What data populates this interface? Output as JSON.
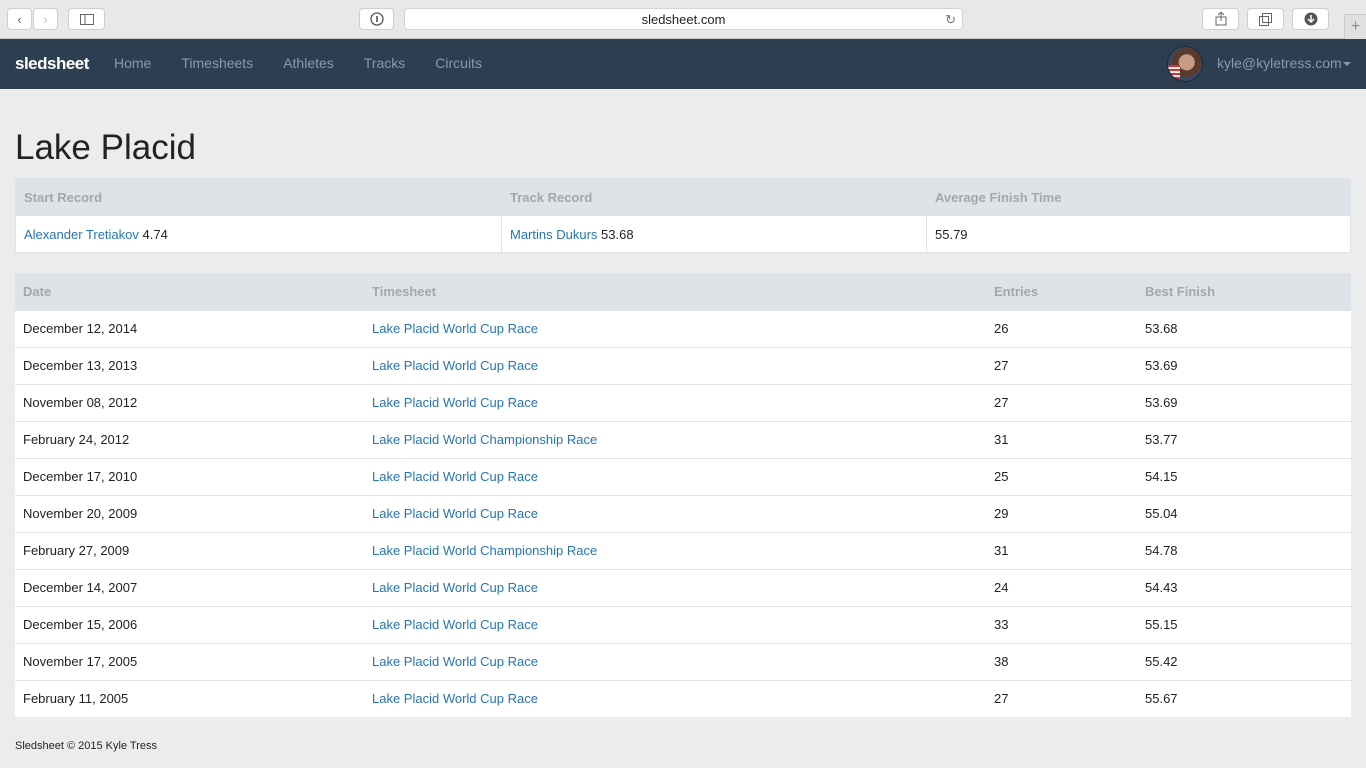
{
  "browser": {
    "url": "sledsheet.com"
  },
  "navbar": {
    "brand": "sledsheet",
    "links": [
      "Home",
      "Timesheets",
      "Athletes",
      "Tracks",
      "Circuits"
    ],
    "user_email": "kyle@kyletress.com"
  },
  "page": {
    "title": "Lake Placid"
  },
  "summary": {
    "headers": [
      "Start Record",
      "Track Record",
      "Average Finish Time"
    ],
    "start_record": {
      "athlete": "Alexander Tretiakov",
      "time": "4.74"
    },
    "track_record": {
      "athlete": "Martins Dukurs",
      "time": "53.68"
    },
    "average_finish": "55.79"
  },
  "races": {
    "headers": [
      "Date",
      "Timesheet",
      "Entries",
      "Best Finish"
    ],
    "rows": [
      {
        "date": "December 12, 2014",
        "timesheet": "Lake Placid World Cup Race",
        "entries": "26",
        "best": "53.68"
      },
      {
        "date": "December 13, 2013",
        "timesheet": "Lake Placid World Cup Race",
        "entries": "27",
        "best": "53.69"
      },
      {
        "date": "November 08, 2012",
        "timesheet": "Lake Placid World Cup Race",
        "entries": "27",
        "best": "53.69"
      },
      {
        "date": "February 24, 2012",
        "timesheet": "Lake Placid World Championship Race",
        "entries": "31",
        "best": "53.77"
      },
      {
        "date": "December 17, 2010",
        "timesheet": "Lake Placid World Cup Race",
        "entries": "25",
        "best": "54.15"
      },
      {
        "date": "November 20, 2009",
        "timesheet": "Lake Placid World Cup Race",
        "entries": "29",
        "best": "55.04"
      },
      {
        "date": "February 27, 2009",
        "timesheet": "Lake Placid World Championship Race",
        "entries": "31",
        "best": "54.78"
      },
      {
        "date": "December 14, 2007",
        "timesheet": "Lake Placid World Cup Race",
        "entries": "24",
        "best": "54.43"
      },
      {
        "date": "December 15, 2006",
        "timesheet": "Lake Placid World Cup Race",
        "entries": "33",
        "best": "55.15"
      },
      {
        "date": "November 17, 2005",
        "timesheet": "Lake Placid World Cup Race",
        "entries": "38",
        "best": "55.42"
      },
      {
        "date": "February 11, 2005",
        "timesheet": "Lake Placid World Cup Race",
        "entries": "27",
        "best": "55.67"
      }
    ]
  },
  "footer": {
    "text": "Sledsheet © 2015 Kyle Tress"
  }
}
